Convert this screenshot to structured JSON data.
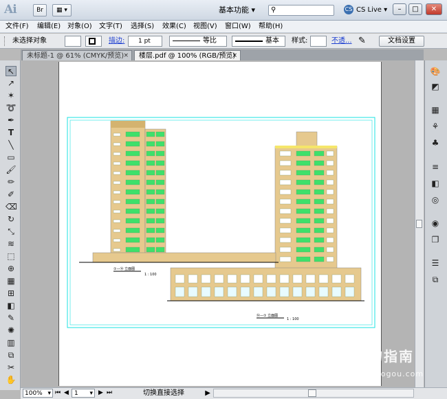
{
  "titlebar": {
    "app_logo": "Ai",
    "btn_br": "Br",
    "workspace": "基本功能",
    "cs_live": "CS Live",
    "cs_icon": "CS"
  },
  "menu": [
    "文件(F)",
    "编辑(E)",
    "对象(O)",
    "文字(T)",
    "选择(S)",
    "效果(C)",
    "视图(V)",
    "窗口(W)",
    "帮助(H)"
  ],
  "control": {
    "selection_status": "未选择对象",
    "stroke_label": "描边:",
    "stroke_value": "1 pt",
    "profile_label": "等比",
    "brush_label": "基本",
    "style_label": "样式:",
    "opacity_link": "不透...",
    "doc_settings": "文档设置"
  },
  "tabs": [
    {
      "label": "未标题-1 @ 61% (CMYK/预览)",
      "close": "×"
    },
    {
      "label": "楼层.pdf @ 100% (RGB/预览)",
      "close": "×"
    }
  ],
  "drawing": {
    "label_left": "①—⑭ 立面图",
    "label_left_scale": "1 : 100",
    "label_right": "⑭—① 立面图",
    "label_right_scale": "1 : 100"
  },
  "status": {
    "zoom": "100%",
    "page": "1",
    "tool_mode": "切换直接选择"
  },
  "watermark": {
    "title": "搜狗指南",
    "url": "zhinan.sogou.com",
    "logo": "S"
  },
  "colors": {
    "building_fill": "#e6c98e",
    "window_green": "#3ee06a",
    "frame_cyan": "#19e3e3"
  }
}
